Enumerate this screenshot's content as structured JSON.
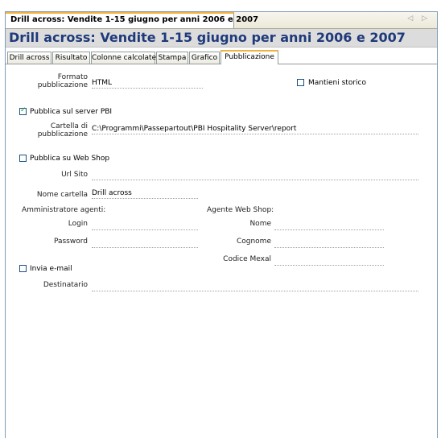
{
  "document_tab": {
    "title": "Drill across: Vendite 1-15 giugno per anni 2006 e 2007",
    "nav": "◁ ▷"
  },
  "page_title": "Drill across: Vendite 1-15 giugno per anni 2006 e 2007",
  "tabs": [
    {
      "label": "Drill across"
    },
    {
      "label": "Risultato"
    },
    {
      "label": "Colonne calcolate"
    },
    {
      "label": "Stampa"
    },
    {
      "label": "Grafico"
    },
    {
      "label": "Pubblicazione",
      "active": true
    }
  ],
  "form": {
    "formato_label": "Formato pubblicazione",
    "formato_value": "HTML",
    "mantieni_storico": {
      "label": "Mantieni storico",
      "checked": false
    },
    "pubblica_server": {
      "label": "Pubblica sul server PBI",
      "checked": true
    },
    "cartella_label": "Cartella di pubblicazione",
    "cartella_value": "C:\\Programmi\\Passepartout\\PBI Hospitality Server\\report",
    "pubblica_webshop": {
      "label": "Pubblica su Web Shop",
      "checked": false
    },
    "url_label": "Url Sito",
    "url_value": "",
    "nome_cartella_label": "Nome cartella",
    "nome_cartella_value": "Drill across",
    "amministratore_label": "Amministratore agenti:",
    "login_label": "Login",
    "login_value": "",
    "password_label": "Password",
    "password_value": "",
    "agente_label": "Agente Web Shop:",
    "nome_label": "Nome",
    "nome_value": "",
    "cognome_label": "Cognome",
    "cognome_value": "",
    "codice_label": "Codice Mexal",
    "codice_value": "",
    "invia_email": {
      "label": "Invia e-mail",
      "checked": false
    },
    "destinatario_label": "Destinatario",
    "destinatario_value": ""
  }
}
